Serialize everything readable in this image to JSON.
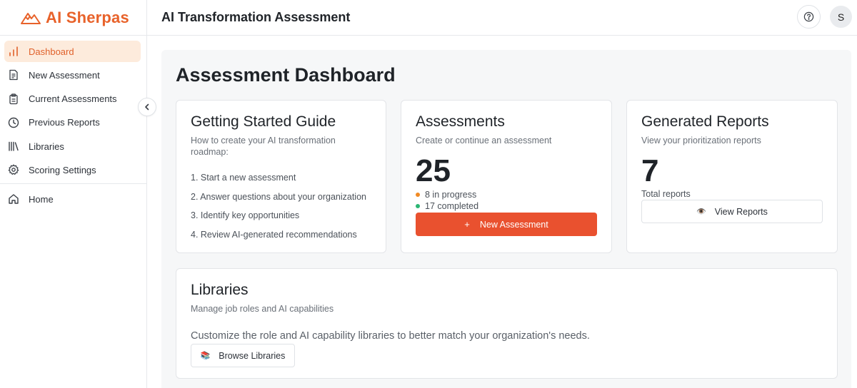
{
  "brand": {
    "name": "AI Sherpas",
    "logo_icon": "mountain-icon",
    "color": "#e8622a"
  },
  "sidebar": {
    "items": [
      {
        "label": "Dashboard",
        "icon": "bar-chart-icon",
        "active": true
      },
      {
        "label": "New Assessment",
        "icon": "document-icon"
      },
      {
        "label": "Current Assessments",
        "icon": "clipboard-icon"
      },
      {
        "label": "Previous Reports",
        "icon": "clock-icon"
      },
      {
        "label": "Libraries",
        "icon": "library-icon"
      },
      {
        "label": "Scoring Settings",
        "icon": "gear-icon"
      }
    ],
    "secondary": [
      {
        "label": "Home",
        "icon": "home-icon"
      }
    ]
  },
  "header": {
    "title": "AI Transformation Assessment",
    "avatar_initial": "S"
  },
  "main": {
    "title": "Assessment Dashboard",
    "getting_started": {
      "title": "Getting Started Guide",
      "subtitle": "How to create your AI transformation roadmap:",
      "steps": [
        "1. Start a new assessment",
        "2. Answer questions about your organization",
        "3. Identify key opportunities",
        "4. Review AI-generated recommendations"
      ]
    },
    "assessments": {
      "title": "Assessments",
      "subtitle": "Create or continue an assessment",
      "count": "25",
      "in_progress": "8 in progress",
      "completed": "17 completed",
      "button_plus": "+",
      "button_label": "New Assessment"
    },
    "reports": {
      "title": "Generated Reports",
      "subtitle": "View your prioritization reports",
      "count": "7",
      "total_label": "Total reports",
      "button_emoji": "👁️",
      "button_label": "View Reports"
    },
    "libraries": {
      "title": "Libraries",
      "subtitle": "Manage job roles and AI capabilities",
      "description": "Customize the role and AI capability libraries to better match your organization's needs.",
      "button_emoji": "📚",
      "button_label": "Browse Libraries"
    }
  },
  "colors": {
    "accent": "#e9512f",
    "active_bg": "#fdebdc",
    "in_progress_dot": "#f08a24",
    "completed_dot": "#2bb673"
  }
}
